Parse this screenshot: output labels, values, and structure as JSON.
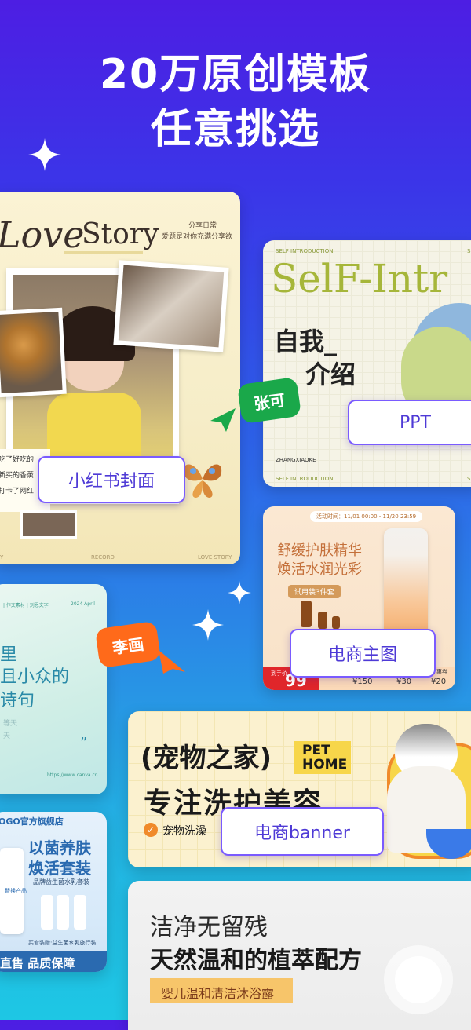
{
  "headline": {
    "line1": "20万原创模板",
    "line2": "任意挑选"
  },
  "icons": [
    "sparkle-icon",
    "cursor-arrow-icon",
    "butterfly-icon",
    "checkmark-icon"
  ],
  "colors": {
    "accent": "#7a5bff",
    "bubble_green": "#1aa84a",
    "bubble_orange": "#ff6a1a"
  },
  "templates": {
    "love_story": {
      "title_script": "Love",
      "title_plain": "Story",
      "side_note_1": "分享日常",
      "side_note_2": "爱题是对你充满分享欲",
      "caption_1": "吃了好吃的",
      "caption_2": "新买的香薰",
      "caption_3": "打卡了网红",
      "footer_left": "Y",
      "footer_mid": "RECORD",
      "footer_right": "LOVE STORY",
      "tag": "小红书封面"
    },
    "self_intro": {
      "top_left": "SELF INTRODUCTION",
      "top_right": "S",
      "big_title": "SelF-Intr",
      "cn_line1": "自我_",
      "cn_line2": "介绍",
      "name": "ZHANGXIAOKE",
      "bottom_left": "SELF INTRODUCTION",
      "bottom_right": "S",
      "tag": "PPT"
    },
    "ecommerce": {
      "activity": "活动时间：11/01 00:00 - 11/20 23:59",
      "line1": "舒缓护肤精华",
      "line2": "焕活水润光彩",
      "trial": "试用装3件套",
      "price_label": "到手价",
      "price": "99",
      "coupon_1": "¥150",
      "coupon_2": "¥30",
      "coupon_3": "¥20",
      "coupon_label": "优惠券",
      "tag": "电商主图"
    },
    "poem": {
      "header": "| 作文素材 | 刘恩文字",
      "year": "2024 April",
      "line1": "里",
      "line2": "且小众的",
      "line3": "诗句",
      "faint_1": "等天",
      "faint_2": "天",
      "url": "https://www.canva.cn"
    },
    "skincare": {
      "store": "OGO官方旗舰店",
      "line1": "以菌养肤",
      "line2": "焕活套装",
      "sub": "品牌益生菌水乳套装",
      "mini": "替换产品",
      "buy": "买套装赠:益生菌水乳旅行装",
      "bottom": "直售 品质保障"
    },
    "pet": {
      "title": "(宠物之家)",
      "pet_en_1": "PET",
      "pet_en_2": "HOME",
      "slogan": "专注洗护美容",
      "feature": "宠物洗澡",
      "tag": "电商banner"
    },
    "baby": {
      "line1": "洁净无留残",
      "line2": "天然温和的植萃配方",
      "product": "婴儿温和清洁沐浴露"
    }
  },
  "bubbles": {
    "green": "张可",
    "orange": "李画"
  }
}
